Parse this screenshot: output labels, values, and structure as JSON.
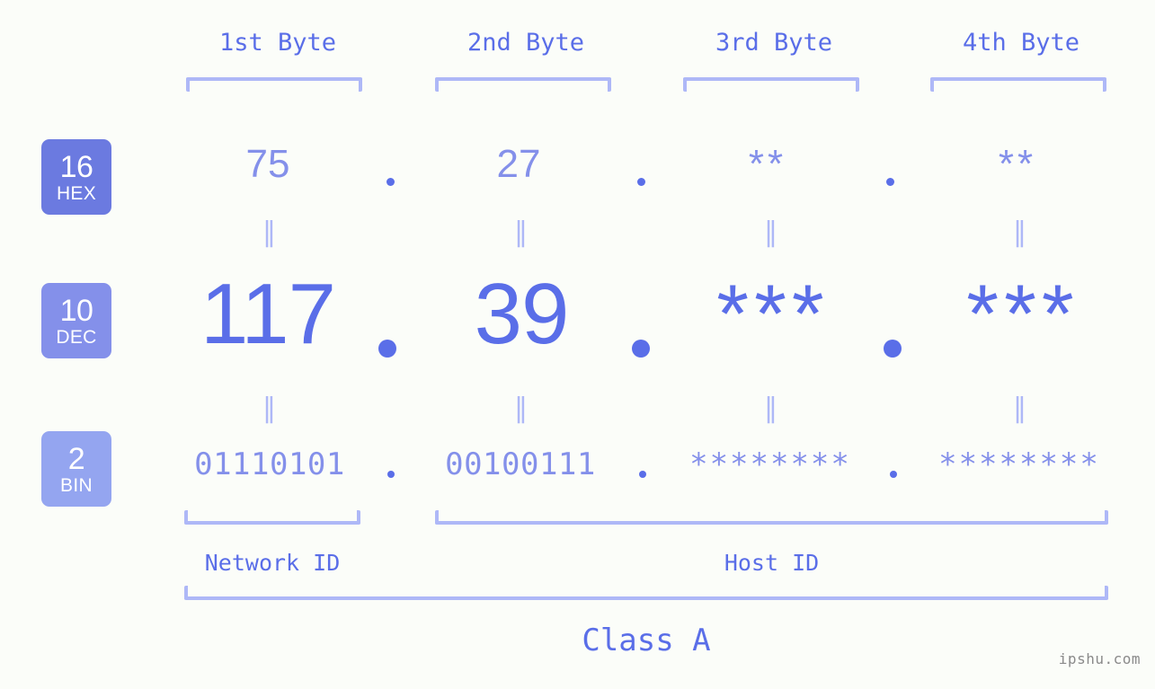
{
  "page": {
    "background_color": "#fbfdf9",
    "accent_color": "#5a6ee8",
    "accent_light_color": "#8490ea",
    "bracket_color": "#aeb8f7",
    "watermark": "ipshu.com"
  },
  "byte_headers": [
    {
      "label": "1st Byte"
    },
    {
      "label": "2nd Byte"
    },
    {
      "label": "3rd Byte"
    },
    {
      "label": "4th Byte"
    }
  ],
  "bases": [
    {
      "number": "16",
      "name": "HEX",
      "color": "#6b7ae0"
    },
    {
      "number": "10",
      "name": "DEC",
      "color": "#8490ea"
    },
    {
      "number": "2",
      "name": "BIN",
      "color": "#94a5f0"
    }
  ],
  "rows": {
    "hex": {
      "base_number": "16",
      "base_name": "HEX",
      "values": [
        "75",
        "27",
        "**",
        "**"
      ],
      "separator": "."
    },
    "dec": {
      "base_number": "10",
      "base_name": "DEC",
      "values": [
        "117",
        "39",
        "***",
        "***"
      ],
      "separator": "."
    },
    "bin": {
      "base_number": "2",
      "base_name": "BIN",
      "values": [
        "01110101",
        "00100111",
        "********",
        "********"
      ],
      "separator": "."
    }
  },
  "equality_marks": {
    "hex_to_dec": [
      "‖",
      "‖",
      "‖",
      "‖"
    ],
    "dec_to_bin": [
      "‖",
      "‖",
      "‖",
      "‖"
    ]
  },
  "id_sections": [
    {
      "label": "Network ID"
    },
    {
      "label": "Host ID"
    }
  ],
  "class": {
    "label": "Class A"
  }
}
